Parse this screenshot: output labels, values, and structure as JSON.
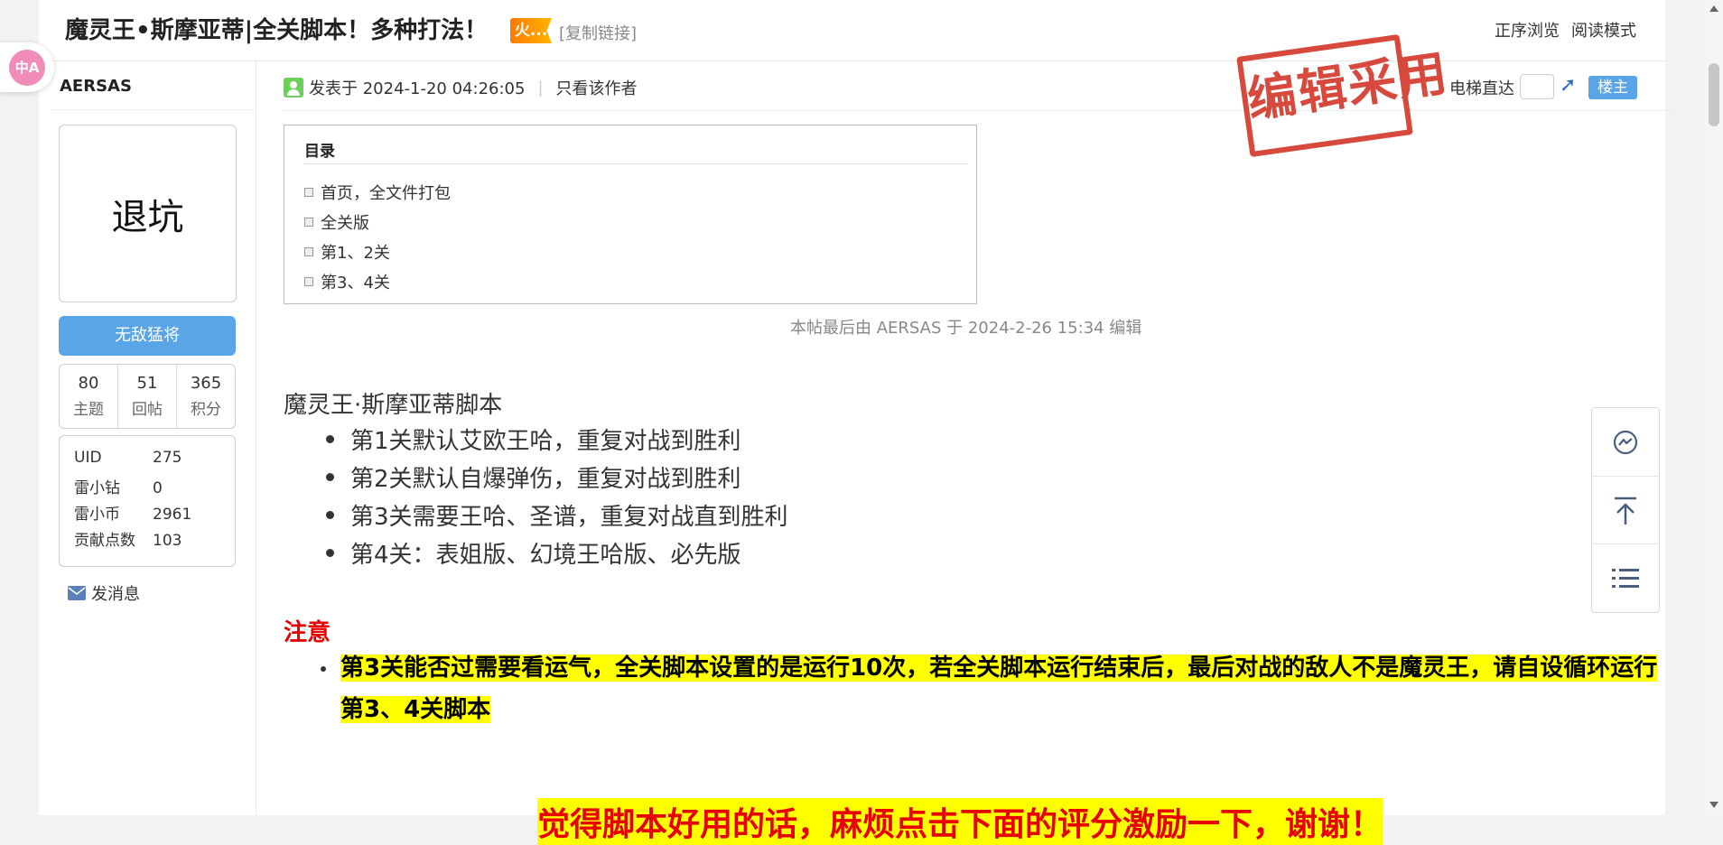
{
  "header": {
    "title": "魔灵王•斯摩亚蒂|全关脚本！多种打法！",
    "hot_badge": "火...",
    "copy_link": "[复制链接]",
    "view_order": "正序浏览",
    "read_mode": "阅读模式"
  },
  "translate": {
    "label": "中A"
  },
  "author": {
    "name": "AERSAS",
    "avatar_text": "退坑",
    "rank": "无敌猛将",
    "stats": [
      {
        "value": "80",
        "label": "主题"
      },
      {
        "value": "51",
        "label": "回帖"
      },
      {
        "value": "365",
        "label": "积分"
      }
    ],
    "info": [
      {
        "key": "UID",
        "value": "275"
      },
      {
        "key": "雷小钻",
        "value": "0"
      },
      {
        "key": "雷小币",
        "value": "2961"
      },
      {
        "key": "贡献点数",
        "value": "103"
      }
    ],
    "send_message": "发消息"
  },
  "post": {
    "posted_at": "发表于 2024-1-20 04:26:05",
    "only_author": "只看该作者",
    "stamp": "编辑采用",
    "elevator_label": "电梯直达",
    "floor_badge": "楼主",
    "toc": {
      "title": "目录",
      "items": [
        "首页，全文件打包",
        "全关版",
        "第1、2关",
        "第3、4关"
      ]
    },
    "edit_note": "本帖最后由 AERSAS 于 2024-2-26 15:34 编辑",
    "content_title": "魔灵王·斯摩亚蒂脚本",
    "content_items": [
      "第1关默认艾欧王哈，重复对战到胜利",
      "第2关默认自爆弹伤，重复对战到胜利",
      "第3关需要王哈、圣谱，重复对战直到胜利",
      "第4关：表姐版、幻境王哈版、必先版"
    ],
    "note_title": "注意",
    "note_text": "第3关能否过需要看运气，全关脚本设置的是运行10次，若全关脚本运行结束后，最后对战的敌人不是魔灵王，请自设循环运行第3、4关脚本",
    "thanks": "觉得脚本好用的话，麻烦点击下面的评分激励一下，谢谢！"
  },
  "colors": {
    "accent_blue": "#5aa5e8",
    "warning_red": "#e60000",
    "highlight_yellow": "#ffff00",
    "stamp_red": "#d33a2c"
  }
}
